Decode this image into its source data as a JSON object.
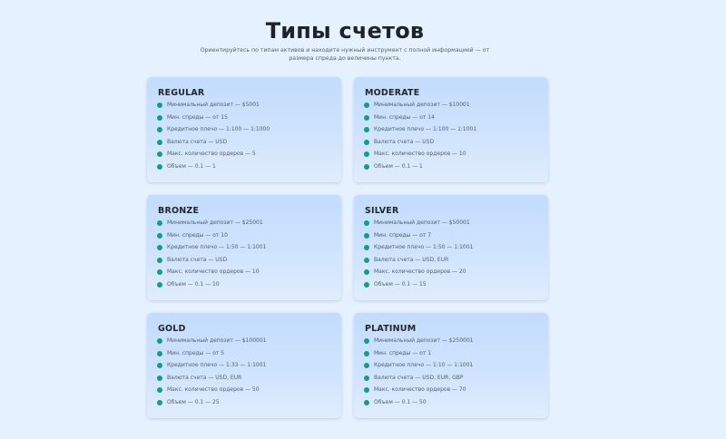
{
  "header": {
    "title": "Типы счетов",
    "subtitle": "Ориентируйтесь по типам активов и находите нужный инструмент с полной информацией — от размера спреда до величины пункта."
  },
  "colors": {
    "background": "#e6f1ff",
    "card": "#c3dcfd",
    "bullet": "#139b8c"
  },
  "accounts": [
    {
      "name": "REGULAR",
      "features": [
        "Минимальный депозит — $5001",
        "Мин. спреды — от 15",
        "Кредитное плечо — 1:100 — 1:1000",
        "Валюта счета — USD",
        "Макс. количество ордеров — 5",
        "Объем — 0.1 — 1"
      ]
    },
    {
      "name": "MODERATE",
      "features": [
        "Минимальный депозит — $10001",
        "Мин. спреды — от 14",
        "Кредитное плечо — 1:100 — 1:1001",
        "Валюта счета — USD",
        "Макс. количество ордеров — 10",
        "Объем — 0.1 — 1"
      ]
    },
    {
      "name": "BRONZE",
      "features": [
        "Минимальный депозит — $25001",
        "Мин. спреды — от 10",
        "Кредитное плечо — 1:50 — 1:1001",
        "Валюта счета — USD",
        "Макс. количество ордеров — 10",
        "Объем — 0.1 — 10"
      ]
    },
    {
      "name": "SILVER",
      "features": [
        "Минимальный депозит — $50001",
        "Мин. спреды — от 7",
        "Кредитное плечо — 1:50 — 1:1001",
        "Валюта счета — USD, EUR",
        "Макс. количество ордеров — 20",
        "Объем — 0.1 — 15"
      ]
    },
    {
      "name": "GOLD",
      "features": [
        "Минимальный депозит — $100001",
        "Мин. спреды — от 5",
        "Кредитное плечо — 1:33 — 1:1001",
        "Валюта счета — USD, EUR",
        "Макс. количество ордеров — 50",
        "Объем — 0.1 — 25"
      ]
    },
    {
      "name": "PLATINUM",
      "features": [
        "Минимальный депозит — $250001",
        "Мин. спреды — от 1",
        "Кредитное плечо — 1:10 — 1:1001",
        "Валюта счета — USD, EUR, GBP",
        "Макс. количество ордеров — 70",
        "Объем — 0.1 — 50"
      ]
    }
  ]
}
